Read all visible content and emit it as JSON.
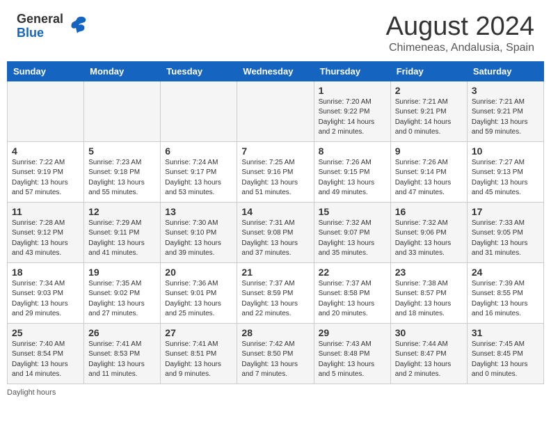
{
  "logo": {
    "general": "General",
    "blue": "Blue"
  },
  "title": "August 2024",
  "subtitle": "Chimeneas, Andalusia, Spain",
  "days_header": [
    "Sunday",
    "Monday",
    "Tuesday",
    "Wednesday",
    "Thursday",
    "Friday",
    "Saturday"
  ],
  "footer": "Daylight hours",
  "weeks": [
    [
      {
        "num": "",
        "info": ""
      },
      {
        "num": "",
        "info": ""
      },
      {
        "num": "",
        "info": ""
      },
      {
        "num": "",
        "info": ""
      },
      {
        "num": "1",
        "info": "Sunrise: 7:20 AM\nSunset: 9:22 PM\nDaylight: 14 hours\nand 2 minutes."
      },
      {
        "num": "2",
        "info": "Sunrise: 7:21 AM\nSunset: 9:21 PM\nDaylight: 14 hours\nand 0 minutes."
      },
      {
        "num": "3",
        "info": "Sunrise: 7:21 AM\nSunset: 9:21 PM\nDaylight: 13 hours\nand 59 minutes."
      }
    ],
    [
      {
        "num": "4",
        "info": "Sunrise: 7:22 AM\nSunset: 9:19 PM\nDaylight: 13 hours\nand 57 minutes."
      },
      {
        "num": "5",
        "info": "Sunrise: 7:23 AM\nSunset: 9:18 PM\nDaylight: 13 hours\nand 55 minutes."
      },
      {
        "num": "6",
        "info": "Sunrise: 7:24 AM\nSunset: 9:17 PM\nDaylight: 13 hours\nand 53 minutes."
      },
      {
        "num": "7",
        "info": "Sunrise: 7:25 AM\nSunset: 9:16 PM\nDaylight: 13 hours\nand 51 minutes."
      },
      {
        "num": "8",
        "info": "Sunrise: 7:26 AM\nSunset: 9:15 PM\nDaylight: 13 hours\nand 49 minutes."
      },
      {
        "num": "9",
        "info": "Sunrise: 7:26 AM\nSunset: 9:14 PM\nDaylight: 13 hours\nand 47 minutes."
      },
      {
        "num": "10",
        "info": "Sunrise: 7:27 AM\nSunset: 9:13 PM\nDaylight: 13 hours\nand 45 minutes."
      }
    ],
    [
      {
        "num": "11",
        "info": "Sunrise: 7:28 AM\nSunset: 9:12 PM\nDaylight: 13 hours\nand 43 minutes."
      },
      {
        "num": "12",
        "info": "Sunrise: 7:29 AM\nSunset: 9:11 PM\nDaylight: 13 hours\nand 41 minutes."
      },
      {
        "num": "13",
        "info": "Sunrise: 7:30 AM\nSunset: 9:10 PM\nDaylight: 13 hours\nand 39 minutes."
      },
      {
        "num": "14",
        "info": "Sunrise: 7:31 AM\nSunset: 9:08 PM\nDaylight: 13 hours\nand 37 minutes."
      },
      {
        "num": "15",
        "info": "Sunrise: 7:32 AM\nSunset: 9:07 PM\nDaylight: 13 hours\nand 35 minutes."
      },
      {
        "num": "16",
        "info": "Sunrise: 7:32 AM\nSunset: 9:06 PM\nDaylight: 13 hours\nand 33 minutes."
      },
      {
        "num": "17",
        "info": "Sunrise: 7:33 AM\nSunset: 9:05 PM\nDaylight: 13 hours\nand 31 minutes."
      }
    ],
    [
      {
        "num": "18",
        "info": "Sunrise: 7:34 AM\nSunset: 9:03 PM\nDaylight: 13 hours\nand 29 minutes."
      },
      {
        "num": "19",
        "info": "Sunrise: 7:35 AM\nSunset: 9:02 PM\nDaylight: 13 hours\nand 27 minutes."
      },
      {
        "num": "20",
        "info": "Sunrise: 7:36 AM\nSunset: 9:01 PM\nDaylight: 13 hours\nand 25 minutes."
      },
      {
        "num": "21",
        "info": "Sunrise: 7:37 AM\nSunset: 8:59 PM\nDaylight: 13 hours\nand 22 minutes."
      },
      {
        "num": "22",
        "info": "Sunrise: 7:37 AM\nSunset: 8:58 PM\nDaylight: 13 hours\nand 20 minutes."
      },
      {
        "num": "23",
        "info": "Sunrise: 7:38 AM\nSunset: 8:57 PM\nDaylight: 13 hours\nand 18 minutes."
      },
      {
        "num": "24",
        "info": "Sunrise: 7:39 AM\nSunset: 8:55 PM\nDaylight: 13 hours\nand 16 minutes."
      }
    ],
    [
      {
        "num": "25",
        "info": "Sunrise: 7:40 AM\nSunset: 8:54 PM\nDaylight: 13 hours\nand 14 minutes."
      },
      {
        "num": "26",
        "info": "Sunrise: 7:41 AM\nSunset: 8:53 PM\nDaylight: 13 hours\nand 11 minutes."
      },
      {
        "num": "27",
        "info": "Sunrise: 7:41 AM\nSunset: 8:51 PM\nDaylight: 13 hours\nand 9 minutes."
      },
      {
        "num": "28",
        "info": "Sunrise: 7:42 AM\nSunset: 8:50 PM\nDaylight: 13 hours\nand 7 minutes."
      },
      {
        "num": "29",
        "info": "Sunrise: 7:43 AM\nSunset: 8:48 PM\nDaylight: 13 hours\nand 5 minutes."
      },
      {
        "num": "30",
        "info": "Sunrise: 7:44 AM\nSunset: 8:47 PM\nDaylight: 13 hours\nand 2 minutes."
      },
      {
        "num": "31",
        "info": "Sunrise: 7:45 AM\nSunset: 8:45 PM\nDaylight: 13 hours\nand 0 minutes."
      }
    ]
  ]
}
